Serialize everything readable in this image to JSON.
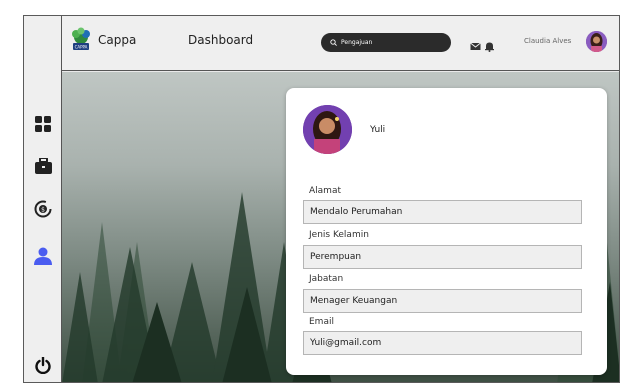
{
  "app": {
    "brand": "Cappa",
    "logo_caption": "CAPPA"
  },
  "nav": {
    "title": "Dashboard"
  },
  "search": {
    "value": "Pengajuan"
  },
  "user": {
    "name": "Claudia Alves"
  },
  "sidebar": {
    "items": [
      {
        "name": "dashboard",
        "icon": "grid-icon"
      },
      {
        "name": "jobs",
        "icon": "briefcase-icon"
      },
      {
        "name": "finance",
        "icon": "coin-cycle-icon"
      },
      {
        "name": "profile",
        "icon": "user-icon",
        "active": true
      },
      {
        "name": "logout",
        "icon": "power-icon"
      }
    ]
  },
  "profile": {
    "name": "Yuli",
    "fields": [
      {
        "label": "Alamat",
        "value": "Mendalo Perumahan"
      },
      {
        "label": "Jenis Kelamin",
        "value": "Perempuan"
      },
      {
        "label": "Jabatan",
        "value": "Menager Keuangan"
      },
      {
        "label": "Email",
        "value": "Yuli@gmail.com"
      }
    ]
  },
  "colors": {
    "accent": "#4a5cf0",
    "search_bg": "#2b2b2b",
    "sidebar_bg": "#efefef"
  }
}
